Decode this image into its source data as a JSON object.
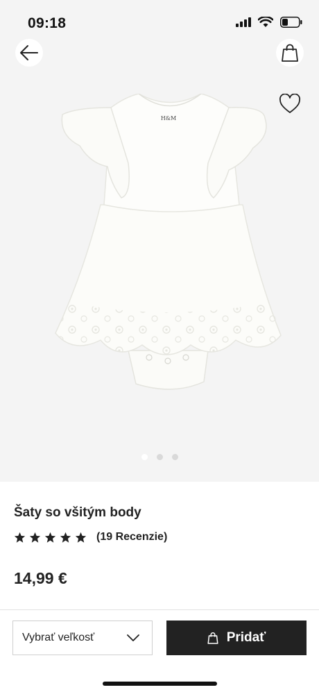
{
  "status_bar": {
    "time": "09:18",
    "icons": [
      "signal-icon",
      "wifi-icon",
      "battery-icon"
    ]
  },
  "header": {
    "back_icon": "back-arrow-icon",
    "bag_icon": "shopping-bag-icon",
    "favorite_icon": "heart-icon"
  },
  "gallery": {
    "image_count": 3,
    "active_index": 0
  },
  "product": {
    "title": "Šaty so všitým body",
    "rating": 5,
    "rating_max": 5,
    "reviews": "(19 Recenzie)",
    "price": "14,99 €",
    "brand_label": "H&M"
  },
  "actions": {
    "size_placeholder": "Vybrať veľkosť",
    "add_label": "Pridať"
  },
  "colors": {
    "background": "#ffffff",
    "hero_background": "#f4f4f4",
    "primary_button": "#222222",
    "primary_text": "#ffffff"
  }
}
